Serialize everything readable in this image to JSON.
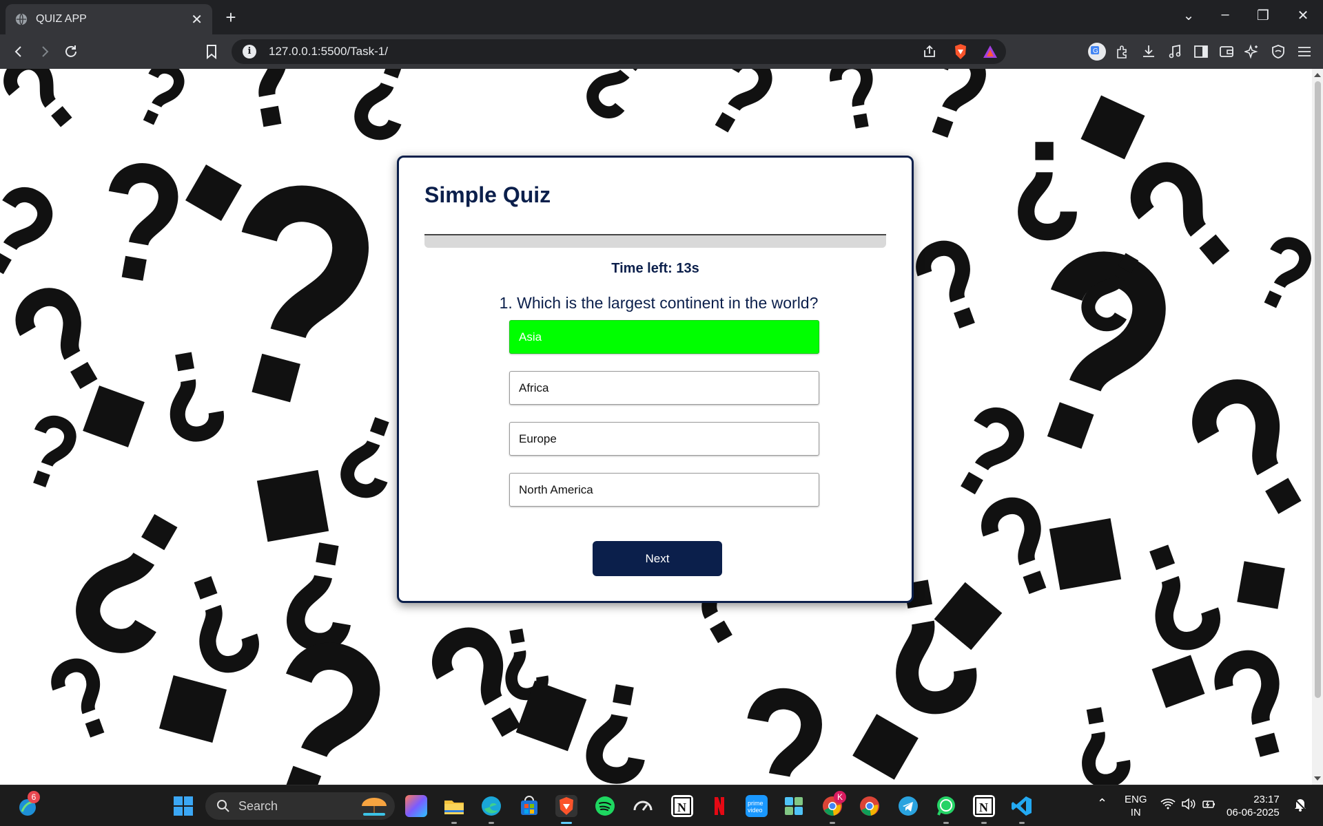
{
  "browser": {
    "tab_title": "QUIZ APP",
    "tab_close": "✕",
    "new_tab": "+",
    "url": "127.0.0.1:5500/Task-1/"
  },
  "quiz": {
    "title": "Simple Quiz",
    "timer": "Time left: 13s",
    "question": "1. Which is the largest continent in the world?",
    "options": [
      {
        "label": "Asia",
        "state": "correct"
      },
      {
        "label": "Africa",
        "state": "default"
      },
      {
        "label": "Europe",
        "state": "default"
      },
      {
        "label": "North America",
        "state": "default"
      }
    ],
    "next_label": "Next",
    "correct_color": "#00ff00",
    "accent_color": "#0b1f4b"
  },
  "taskbar": {
    "search_placeholder": "Search",
    "notification_count": "6",
    "chrome_badge": "K",
    "lang_line1": "ENG",
    "lang_line2": "IN",
    "time": "23:17",
    "date": "06-06-2025"
  }
}
